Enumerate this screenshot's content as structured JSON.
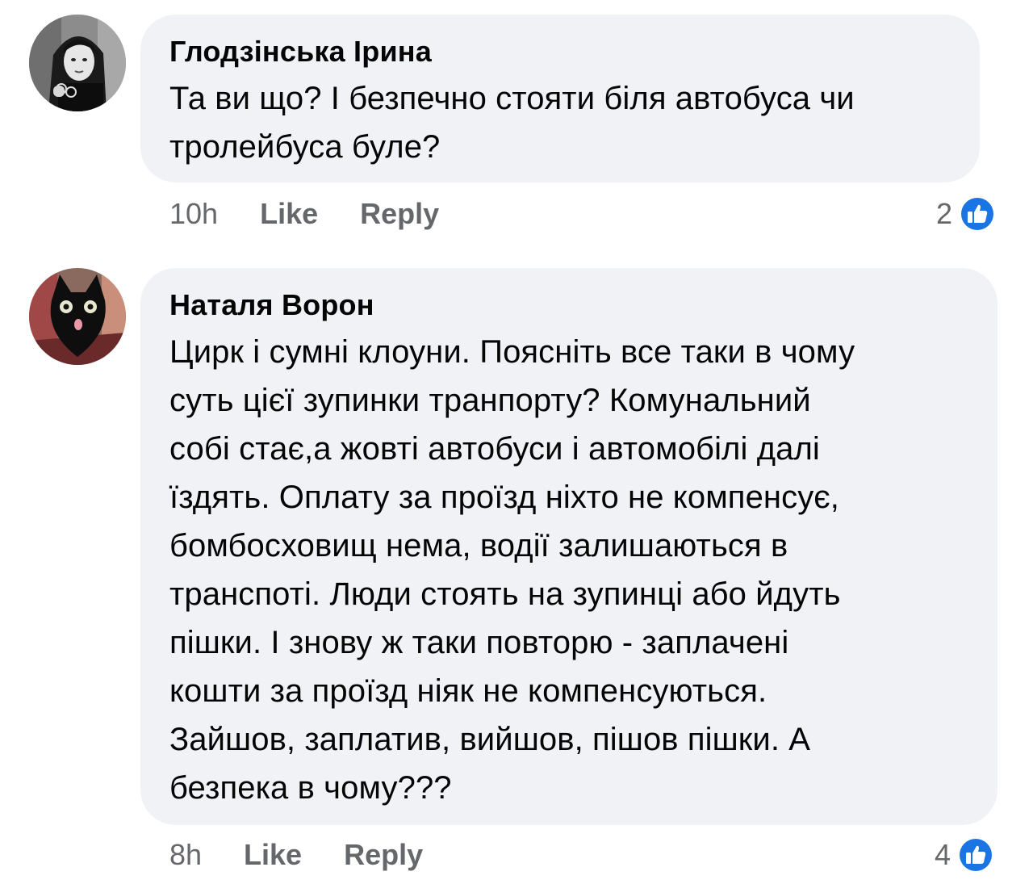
{
  "comments": [
    {
      "author": "Глодзінська Ірина",
      "text": "Та ви що? І безпечно стояти біля автобуса чи\nтролейбуса буле?",
      "time": "10h",
      "like_label": "Like",
      "reply_label": "Reply",
      "like_count": "2",
      "avatar": "woman-portrait-bw"
    },
    {
      "author": "Наталя Ворон",
      "text": "Цирк і сумні клоуни. Поясніть все таки в чому\nсуть цієї зупинки транпорту? Комунальний\nсобі стає,а жовті автобуси і автомобілі далі\nїздять. Оплату за проїзд ніхто не компенсує,\nбомбосховищ нема, водії залишаються в\nтранспоті. Люди стоять на зупинці або йдуть\nпішки. І знову ж таки повторю - заплачені\nкошти за проїзд ніяк не компенсуються.\nЗайшов, заплатив, вийшов, пішов пішки. А\nбезпека в чому???",
      "time": "8h",
      "like_label": "Like",
      "reply_label": "Reply",
      "like_count": "4",
      "avatar": "black-cat"
    }
  ],
  "colors": {
    "bubble_bg": "#f0f2f5",
    "meta_text": "#65676b",
    "like_blue": "#1b74e4"
  },
  "icons": {
    "reaction": "thumbs-up-icon"
  }
}
